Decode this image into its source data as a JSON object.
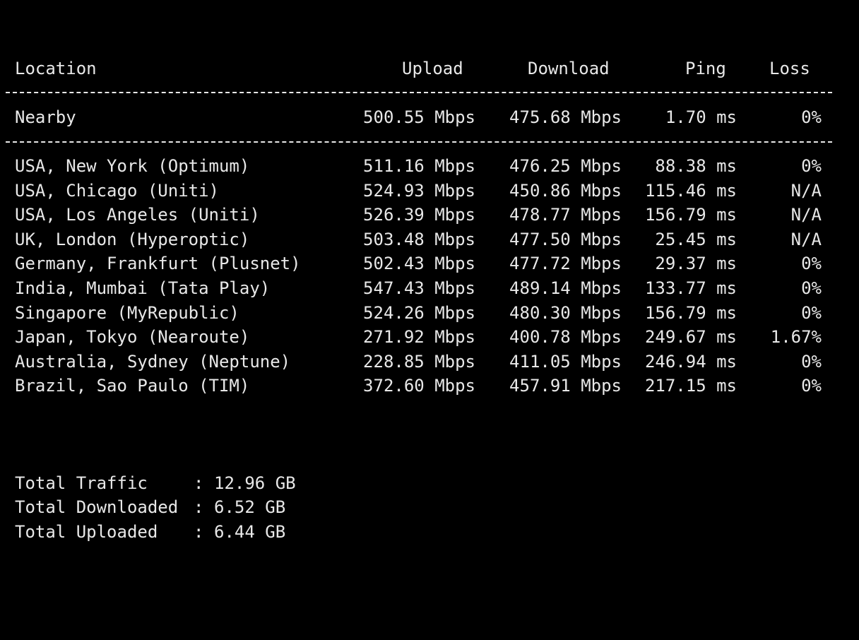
{
  "colors": {
    "background": "#000000",
    "text": "#e8e8e8"
  },
  "table": {
    "headers": {
      "location": "Location",
      "upload": "Upload",
      "download": "Download",
      "ping": "Ping",
      "loss": "Loss"
    },
    "nearby": {
      "location": "Nearby",
      "upload": "500.55 Mbps",
      "download": "475.68 Mbps",
      "ping": "1.70 ms",
      "loss": "0%"
    },
    "rows": [
      {
        "location": "USA, New York (Optimum)",
        "upload": "511.16 Mbps",
        "download": "476.25 Mbps",
        "ping": "88.38 ms",
        "loss": "0%"
      },
      {
        "location": "USA, Chicago (Uniti)",
        "upload": "524.93 Mbps",
        "download": "450.86 Mbps",
        "ping": "115.46 ms",
        "loss": "N/A"
      },
      {
        "location": "USA, Los Angeles (Uniti)",
        "upload": "526.39 Mbps",
        "download": "478.77 Mbps",
        "ping": "156.79 ms",
        "loss": "N/A"
      },
      {
        "location": "UK, London (Hyperoptic)",
        "upload": "503.48 Mbps",
        "download": "477.50 Mbps",
        "ping": "25.45 ms",
        "loss": "N/A"
      },
      {
        "location": "Germany, Frankfurt (Plusnet)",
        "upload": "502.43 Mbps",
        "download": "477.72 Mbps",
        "ping": "29.37 ms",
        "loss": "0%"
      },
      {
        "location": "India, Mumbai (Tata Play)",
        "upload": "547.43 Mbps",
        "download": "489.14 Mbps",
        "ping": "133.77 ms",
        "loss": "0%"
      },
      {
        "location": "Singapore (MyRepublic)",
        "upload": "524.26 Mbps",
        "download": "480.30 Mbps",
        "ping": "156.79 ms",
        "loss": "0%"
      },
      {
        "location": "Japan, Tokyo (Nearoute)",
        "upload": "271.92 Mbps",
        "download": "400.78 Mbps",
        "ping": "249.67 ms",
        "loss": "1.67%"
      },
      {
        "location": "Australia, Sydney (Neptune)",
        "upload": "228.85 Mbps",
        "download": "411.05 Mbps",
        "ping": "246.94 ms",
        "loss": "0%"
      },
      {
        "location": "Brazil, Sao Paulo (TIM)",
        "upload": "372.60 Mbps",
        "download": "457.91 Mbps",
        "ping": "217.15 ms",
        "loss": "0%"
      }
    ]
  },
  "summary": [
    {
      "label": "Total Traffic",
      "separator": ":",
      "value": "12.96 GB"
    },
    {
      "label": "Total Downloaded",
      "separator": ":",
      "value": "6.52 GB"
    },
    {
      "label": "Total Uploaded",
      "separator": ":",
      "value": "6.44 GB"
    }
  ]
}
